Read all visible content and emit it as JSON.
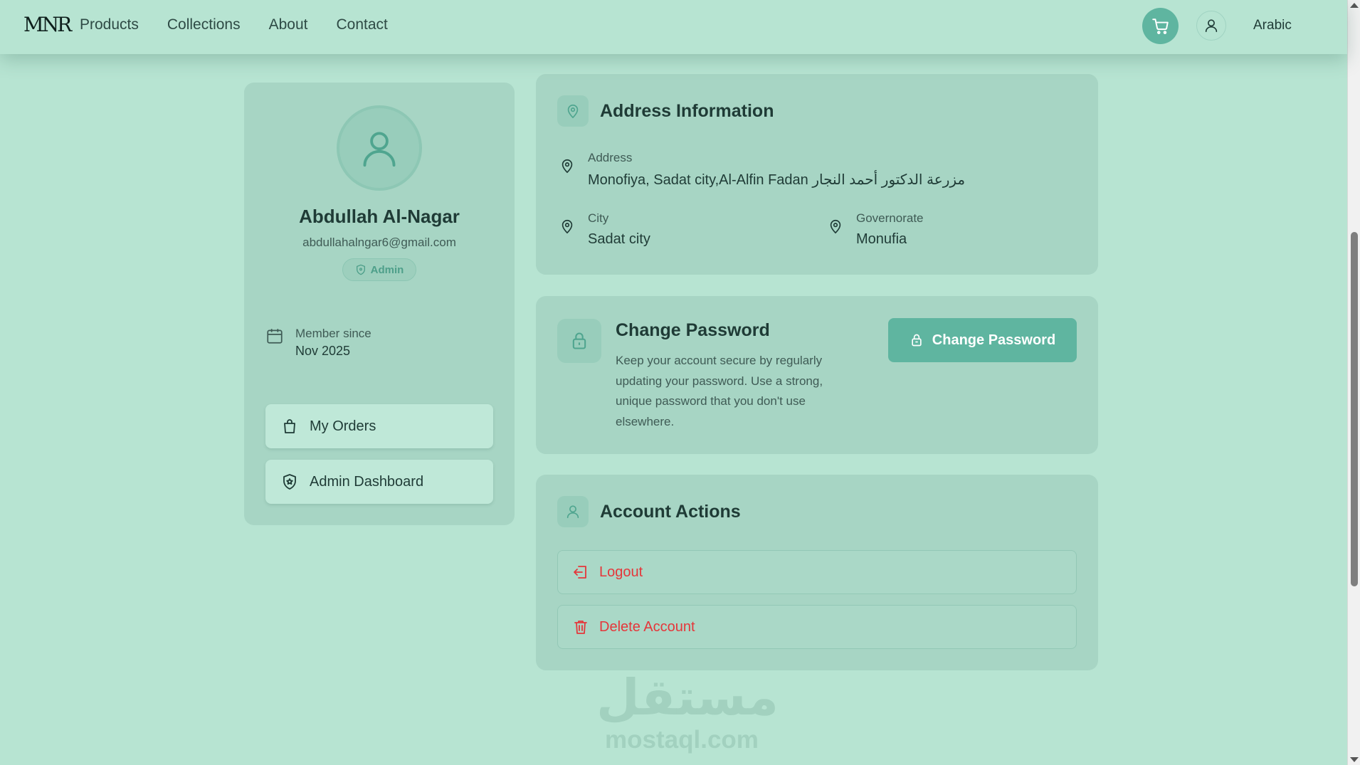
{
  "header": {
    "logo": "MNR",
    "nav": [
      "Products",
      "Collections",
      "About",
      "Contact"
    ],
    "language": "Arabic",
    "cart_icon": "cart-icon",
    "user_icon": "user-icon"
  },
  "profile": {
    "name": "Abdullah Al-Nagar",
    "email": "abdullahalngar6@gmail.com",
    "role_badge": "Admin",
    "member_since_label": "Member since",
    "member_since_value": "Nov 2025",
    "buttons": {
      "orders": "My Orders",
      "admin_dashboard": "Admin Dashboard"
    }
  },
  "address_card": {
    "title": "Address Information",
    "address_label": "Address",
    "address_value": "Monofiya, Sadat city,Al-Alfin Fadan مزرعة الدكتور أحمد النجار",
    "city_label": "City",
    "city_value": "Sadat city",
    "governorate_label": "Governorate",
    "governorate_value": "Monufia"
  },
  "password_card": {
    "title": "Change Password",
    "description": "Keep your account secure by regularly updating your password. Use a strong, unique password that you don't use elsewhere.",
    "button": "Change Password"
  },
  "actions_card": {
    "title": "Account Actions",
    "logout": "Logout",
    "delete": "Delete Account"
  },
  "watermark": {
    "arabic": "مستقل",
    "latin": "mostaql.com"
  },
  "colors": {
    "background": "#b7e4d2",
    "card": "#a7d5c4",
    "accent": "#5fb5a0",
    "danger": "#e5363a"
  }
}
